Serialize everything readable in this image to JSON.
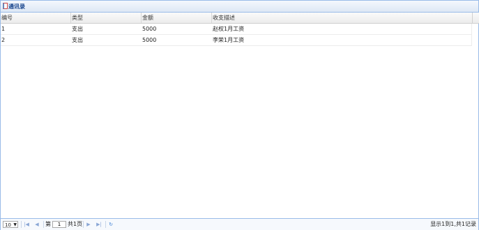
{
  "panel": {
    "title": "通讯录"
  },
  "grid": {
    "columns": [
      "编号",
      "类型",
      "金额",
      "收支描述"
    ],
    "rows": [
      [
        "1",
        "支出",
        "5000",
        "赵权1月工资"
      ],
      [
        "2",
        "支出",
        "5000",
        "李荣1月工资"
      ]
    ]
  },
  "pager": {
    "page_size": "10",
    "page_prefix": "第",
    "page_value": "1",
    "page_suffix": "共1页",
    "info": "显示1到1,共1记录"
  }
}
